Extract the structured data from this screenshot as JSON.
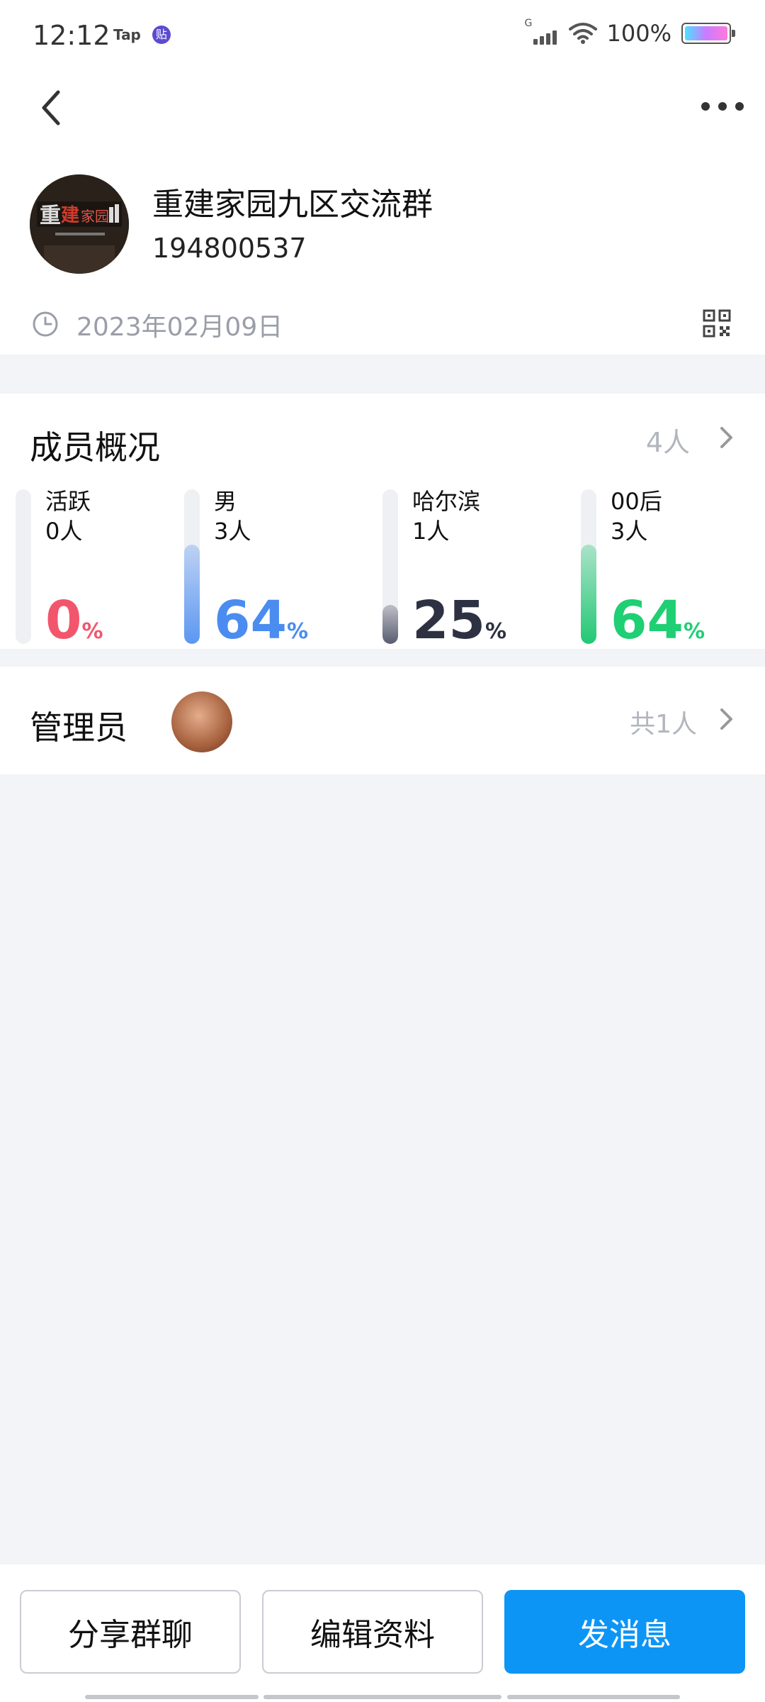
{
  "status_bar": {
    "time": "12:12",
    "notif_app_1": "Tap",
    "notif_app_2": "贴",
    "network_label": "G",
    "battery_percent": "100%"
  },
  "header": {
    "back_icon": "chevron-left-icon",
    "more_icon": "more-dots-icon"
  },
  "group": {
    "name": "重建家园九区交流群",
    "id": "194800537",
    "created_date": "2023年02月09日"
  },
  "members": {
    "title": "成员概况",
    "count": "4人",
    "stats": [
      {
        "label": "活跃",
        "count": "0人",
        "percent": "0",
        "unit": "%",
        "value": 0,
        "color": "#f2566d",
        "bar_color": "#f2566d"
      },
      {
        "label": "男",
        "count": "3人",
        "percent": "64",
        "unit": "%",
        "value": 64,
        "color": "#4a8cf0",
        "bar_color": "#5b97f2"
      },
      {
        "label": "哈尔滨",
        "count": "1人",
        "percent": "25",
        "unit": "%",
        "value": 25,
        "color": "#2d3142",
        "bar_color": "#585c6e"
      },
      {
        "label": "00后",
        "count": "3人",
        "percent": "64",
        "unit": "%",
        "value": 64,
        "color": "#1fcf73",
        "bar_color": "#22c874"
      }
    ]
  },
  "admins": {
    "title": "管理员",
    "count": "共1人"
  },
  "actions": {
    "share_label": "分享群聊",
    "edit_label": "编辑资料",
    "send_label": "发消息"
  },
  "colors": {
    "primary": "#0d95f6",
    "background": "#f3f4f8"
  }
}
